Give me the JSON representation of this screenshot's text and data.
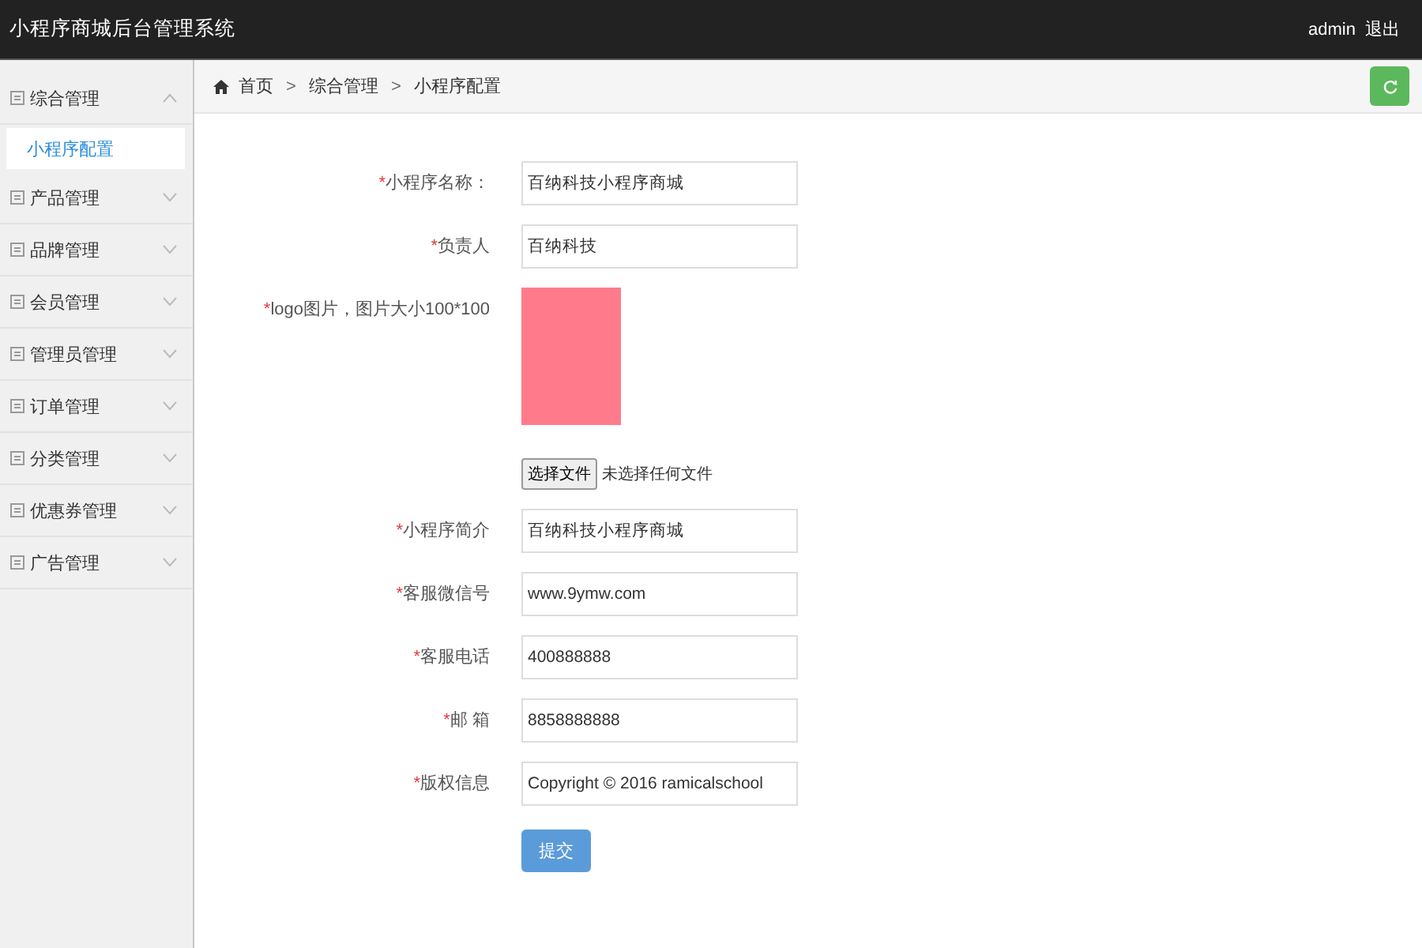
{
  "header": {
    "title": "小程序商城后台管理系统",
    "user": "admin",
    "logout": "退出"
  },
  "sidebar": {
    "items": [
      {
        "label": "综合管理",
        "expanded": true,
        "children": [
          {
            "label": "小程序配置",
            "selected": true
          }
        ]
      },
      {
        "label": "产品管理",
        "expanded": false
      },
      {
        "label": "品牌管理",
        "expanded": false
      },
      {
        "label": "会员管理",
        "expanded": false
      },
      {
        "label": "管理员管理",
        "expanded": false
      },
      {
        "label": "订单管理",
        "expanded": false
      },
      {
        "label": "分类管理",
        "expanded": false
      },
      {
        "label": "优惠券管理",
        "expanded": false
      },
      {
        "label": "广告管理",
        "expanded": false
      }
    ]
  },
  "breadcrumb": {
    "items": [
      "首页",
      "综合管理",
      "小程序配置"
    ],
    "separator": ">"
  },
  "form": {
    "fields": [
      {
        "kind": "text",
        "mark": "*",
        "label": "小程序名称：",
        "value": "百纳科技小程序商城"
      },
      {
        "kind": "text",
        "mark": "*",
        "label": "负责人",
        "value": "百纳科技"
      },
      {
        "kind": "image",
        "mark": "*",
        "label": "logo图片，图片大小100*100",
        "button": "选择文件",
        "file_status": "未选择任何文件"
      },
      {
        "kind": "text",
        "mark": "*",
        "label": "小程序简介",
        "value": "百纳科技小程序商城"
      },
      {
        "kind": "text",
        "mark": "*",
        "label": "客服微信号",
        "value": "www.9ymw.com"
      },
      {
        "kind": "text",
        "mark": "*",
        "label": "客服电话",
        "value": "400888888"
      },
      {
        "kind": "text",
        "mark": "*",
        "label": "邮 箱",
        "value": "8858888888"
      },
      {
        "kind": "text",
        "mark": "*",
        "label": "版权信息",
        "value": "Copyright © 2016 ramicalschool"
      }
    ],
    "submit": "提交"
  }
}
